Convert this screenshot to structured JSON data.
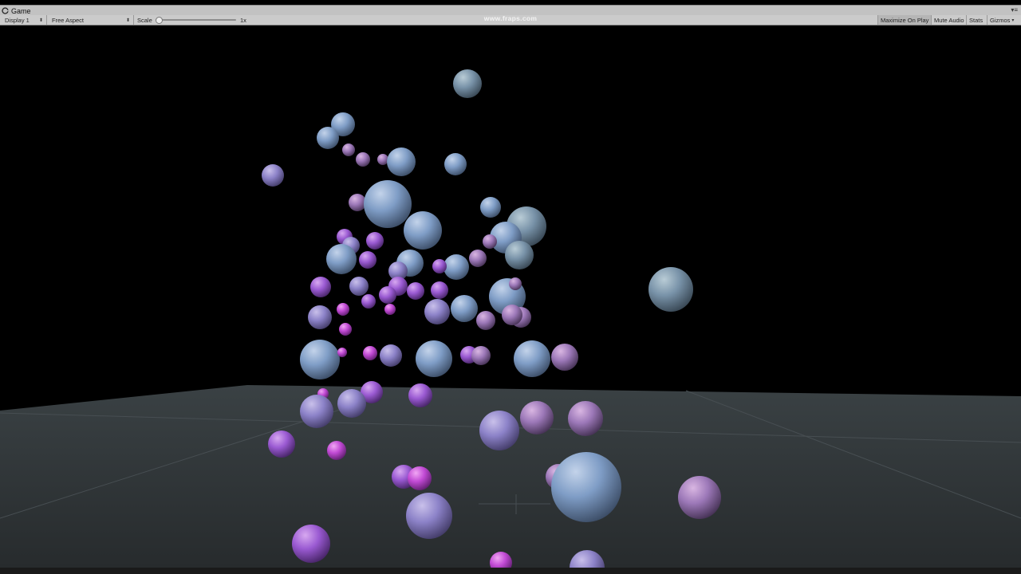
{
  "tab": {
    "title": "Game",
    "icon": "game-controller-icon"
  },
  "toolbar": {
    "display": "Display 1",
    "aspect": "Free Aspect",
    "scale_label": "Scale",
    "scale_value": "1x",
    "scale_fraction": 0.0,
    "maximize_on_play": "Maximize On Play",
    "mute_audio": "Mute Audio",
    "stats": "Stats",
    "gizmos": "Gizmos"
  },
  "watermark": "www.fraps.com",
  "scene": {
    "description_colors": {
      "background": "#000000",
      "ground": "#2c3133",
      "sphere_blue": "#7f9dc6",
      "sphere_purple": "#a86ad8",
      "sphere_magenta": "#c44bd6"
    },
    "sphere_count": 95
  }
}
